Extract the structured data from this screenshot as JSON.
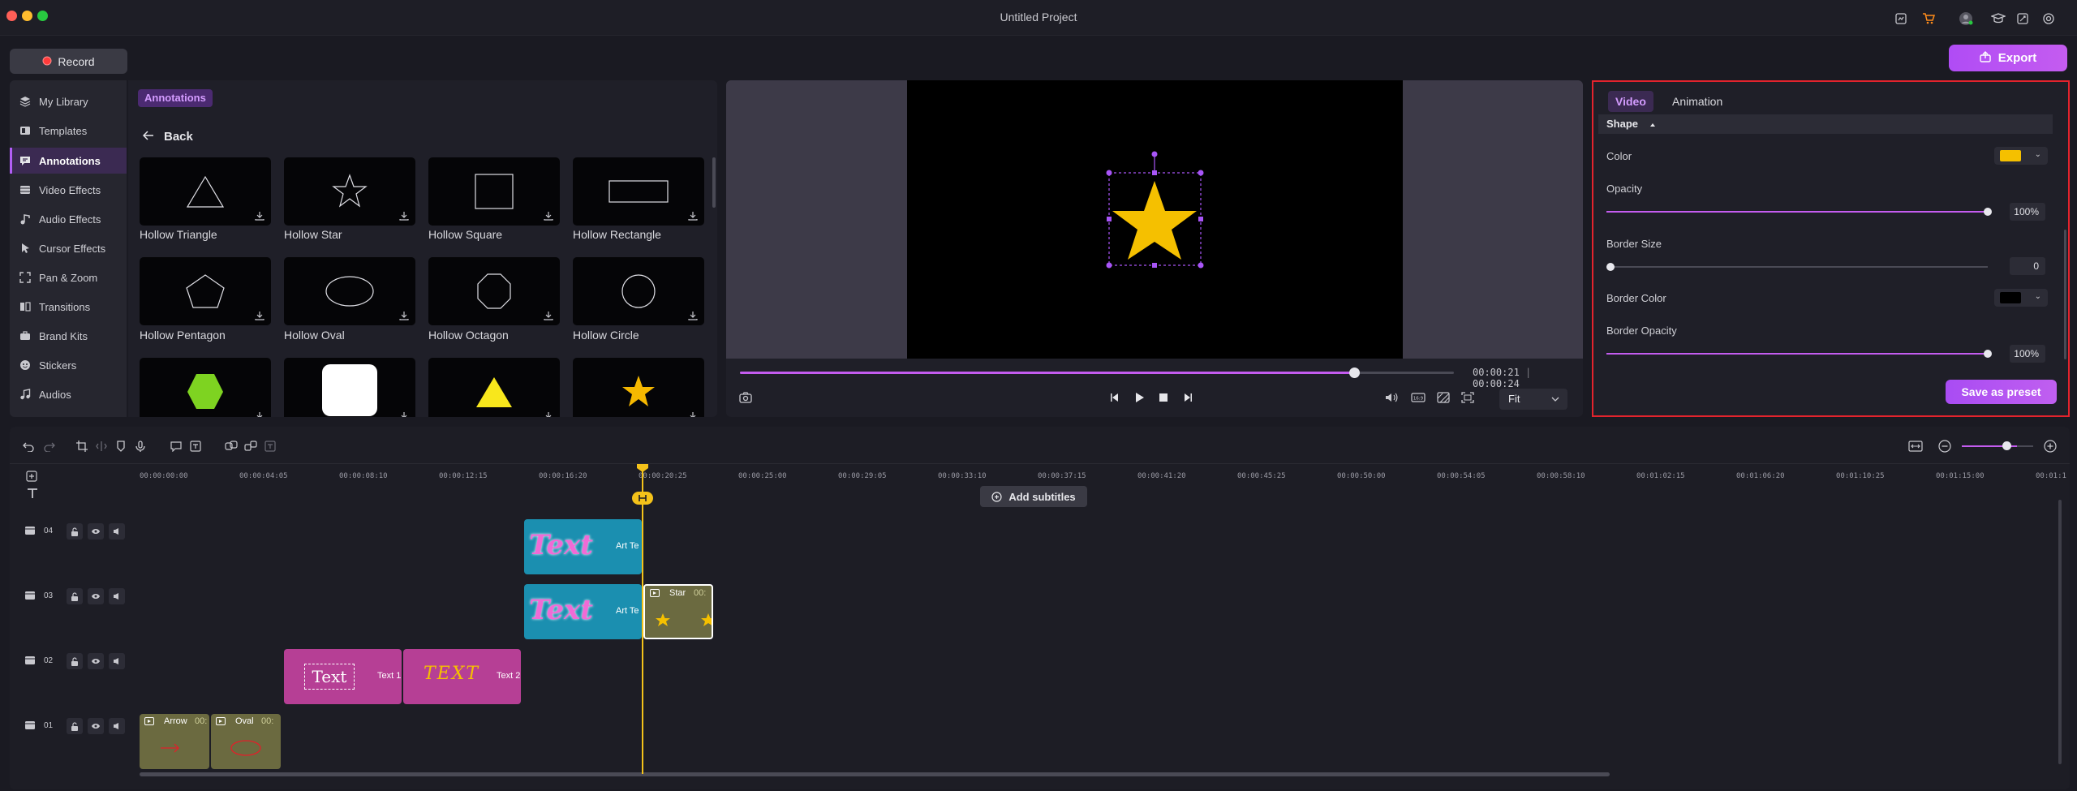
{
  "window": {
    "title": "Untitled Project",
    "record_label": "Record",
    "export_label": "Export"
  },
  "sidebar": {
    "items": [
      {
        "label": "My Library",
        "icon": "layers-icon"
      },
      {
        "label": "Templates",
        "icon": "templates-icon"
      },
      {
        "label": "Annotations",
        "icon": "annotation-icon",
        "active": true
      },
      {
        "label": "Video Effects",
        "icon": "video-effects-icon"
      },
      {
        "label": "Audio Effects",
        "icon": "audio-effects-icon"
      },
      {
        "label": "Cursor Effects",
        "icon": "cursor-icon"
      },
      {
        "label": "Pan & Zoom",
        "icon": "pan-zoom-icon"
      },
      {
        "label": "Transitions",
        "icon": "transitions-icon"
      },
      {
        "label": "Brand Kits",
        "icon": "brand-kit-icon"
      },
      {
        "label": "Stickers",
        "icon": "sticker-icon"
      },
      {
        "label": "Audios",
        "icon": "music-icon"
      }
    ]
  },
  "library": {
    "tag": "Annotations",
    "back_label": "Back",
    "cards": [
      {
        "label": "Hollow Triangle"
      },
      {
        "label": "Hollow Star"
      },
      {
        "label": "Hollow Square"
      },
      {
        "label": "Hollow Rectangle"
      },
      {
        "label": "Hollow Pentagon"
      },
      {
        "label": "Hollow Oval"
      },
      {
        "label": "Hollow Octagon"
      },
      {
        "label": "Hollow Circle"
      }
    ],
    "shape_colors": {
      "hexagon": "#7ed321",
      "rounded_square": "#ffffff",
      "triangle": "#f8e71c",
      "star": "#f5b800"
    }
  },
  "preview": {
    "current_time": "00:00:21",
    "total_time": "00:00:24",
    "progress": 0.86,
    "fit_label": "Fit",
    "star_color": "#f5c000"
  },
  "properties": {
    "tabs": [
      "Video",
      "Animation"
    ],
    "section": "Shape",
    "color_label": "Color",
    "color_value": "#f5c000",
    "opacity_label": "Opacity",
    "opacity_value": "100%",
    "opacity_level": 1.0,
    "border_size_label": "Border Size",
    "border_size_value": "0",
    "border_size_level": 0.0,
    "border_color_label": "Border Color",
    "border_color_value": "#000000",
    "border_opacity_label": "Border Opacity",
    "border_opacity_value": "100%",
    "border_opacity_level": 1.0,
    "save_preset_label": "Save as preset"
  },
  "timeline": {
    "ruler": [
      "00:00:00:00",
      "00:00:04:05",
      "00:00:08:10",
      "00:00:12:15",
      "00:00:16:20",
      "00:00:20:25",
      "00:00:25:00",
      "00:00:29:05",
      "00:00:33:10",
      "00:00:37:15",
      "00:00:41:20",
      "00:00:45:25",
      "00:00:50:00",
      "00:00:54:05",
      "00:00:58:10",
      "00:01:02:15",
      "00:01:06:20",
      "00:01:10:25",
      "00:01:15:00",
      "00:01:1"
    ],
    "add_subtitles_label": "Add subtitles",
    "tracks": [
      "04",
      "03",
      "02",
      "01"
    ],
    "clips": {
      "art_text_label": "Art Te",
      "text_word": "Text",
      "star_label": "Star",
      "star_time": "00:",
      "text1_box": "Text",
      "text1_label": "Text 1",
      "text2_box": "TEXT",
      "text2_label": "Text 2",
      "arrow_label": "Arrow",
      "arrow_time": "00:",
      "oval_label": "Oval",
      "oval_time": "00:"
    }
  }
}
